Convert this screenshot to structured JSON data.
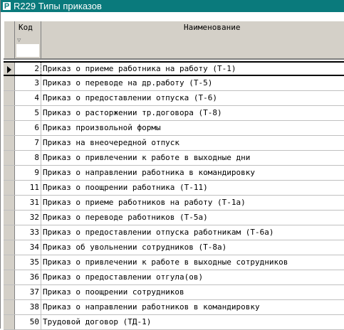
{
  "window": {
    "title": "R229 Типы приказов",
    "icon": "app-icon"
  },
  "columns": {
    "code": "Код",
    "name": "Наименование"
  },
  "rows": [
    {
      "code": "2",
      "name": "Приказ о приеме работника на работу (Т-1)"
    },
    {
      "code": "3",
      "name": "Приказ о переводе на др.работу (Т-5)"
    },
    {
      "code": "4",
      "name": "Приказ о предоставлении отпуска (Т-6)"
    },
    {
      "code": "5",
      "name": "Приказ о расторжении тр.договора (Т-8)"
    },
    {
      "code": "6",
      "name": "Приказ произвольной формы"
    },
    {
      "code": "7",
      "name": "Приказ на внеочередной отпуск"
    },
    {
      "code": "8",
      "name": "Приказ о привлечении к работе в выходные дни"
    },
    {
      "code": "9",
      "name": "Приказ о направлении работника в командировку"
    },
    {
      "code": "11",
      "name": "Приказ о поощрении работника (Т-11)"
    },
    {
      "code": "31",
      "name": "Приказ о приеме работников на работу (Т-1а)"
    },
    {
      "code": "32",
      "name": "Приказ о переводе работников (Т-5а)"
    },
    {
      "code": "33",
      "name": "Приказ о предоставлении отпуска работникам (Т-6а)"
    },
    {
      "code": "34",
      "name": "Приказ об увольнении сотрудников (Т-8а)"
    },
    {
      "code": "35",
      "name": "Приказ о привлечении к работе в выходные сотрудников"
    },
    {
      "code": "36",
      "name": "Приказ о предоставлении отгула(ов)"
    },
    {
      "code": "37",
      "name": "Приказ о поощрении сотрудников"
    },
    {
      "code": "38",
      "name": "Приказ о направлении работников в командировку"
    },
    {
      "code": "50",
      "name": "Трудовой договор (ТД-1)"
    }
  ],
  "selected_index": 0,
  "colors": {
    "titlebar": "#0a7a7c",
    "header": "#d4d0c8"
  }
}
